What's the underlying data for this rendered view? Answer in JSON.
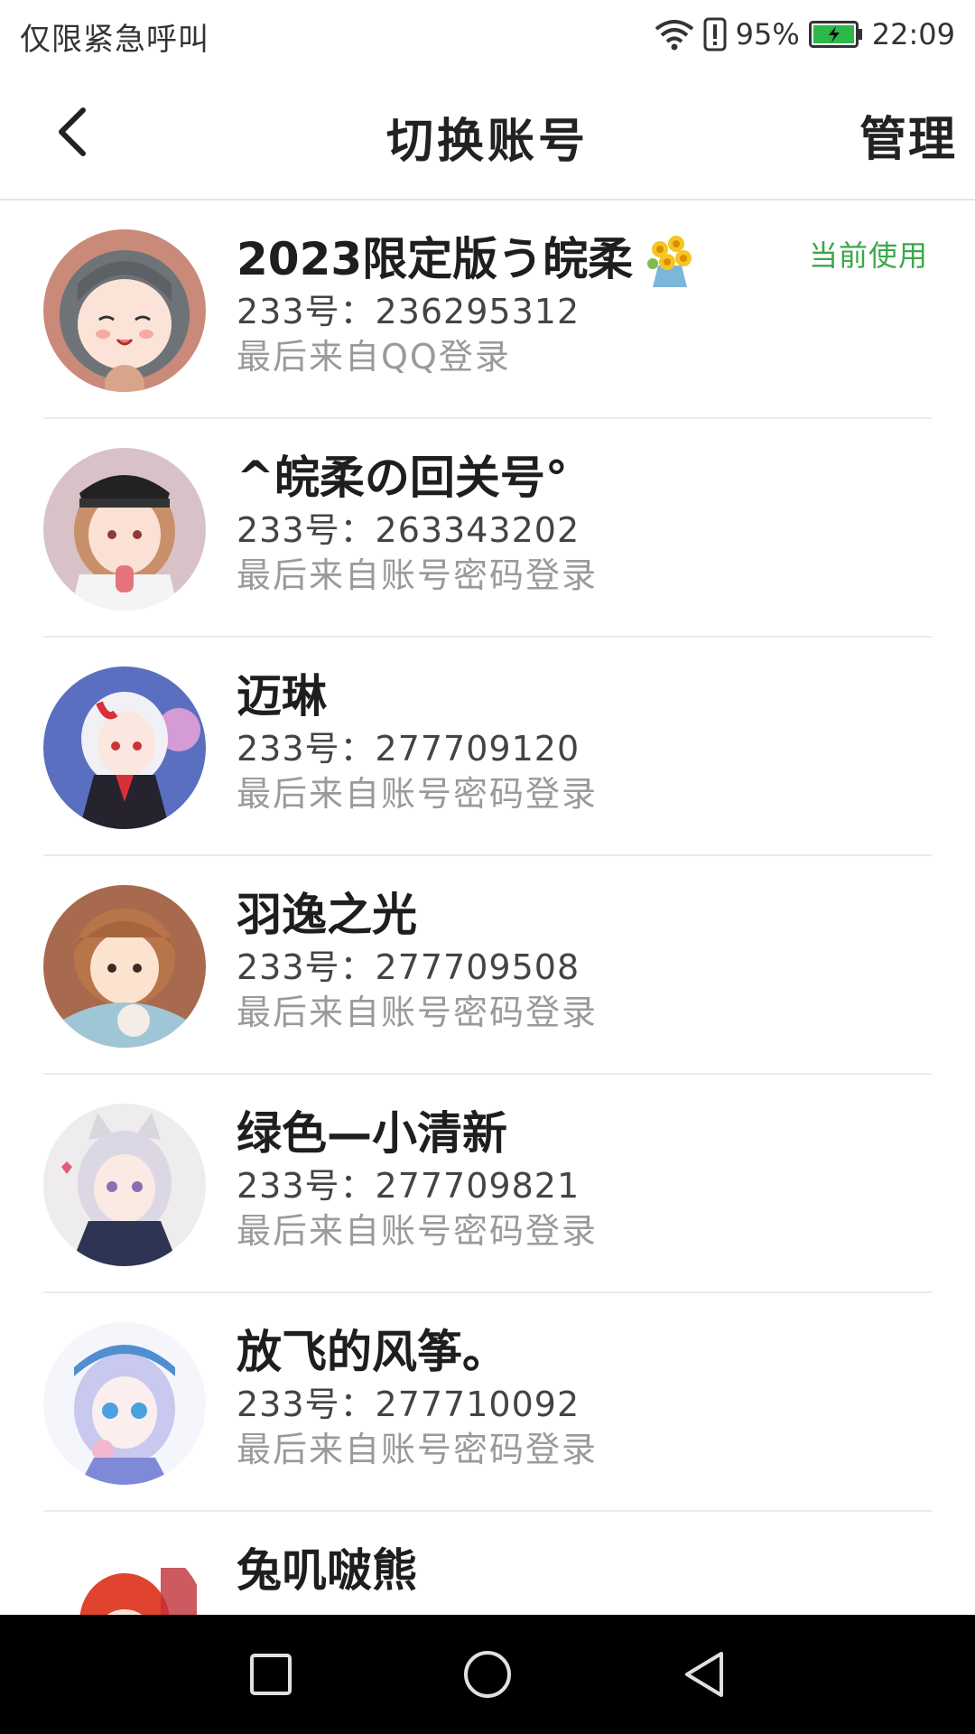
{
  "status_bar": {
    "carrier_text": "仅限紧急呼叫",
    "battery_percent": "95%",
    "time": "22:09",
    "icons": [
      "wifi-icon",
      "alert-icon",
      "battery-charging-icon"
    ]
  },
  "header": {
    "title": "切换账号",
    "manage_label": "管理",
    "back_icon": "chevron-left-icon"
  },
  "accounts": [
    {
      "name": "2023限定版う皖柔",
      "id_text": "233号：236295312",
      "login_text": "最后来自QQ登录",
      "badge": "当前使用",
      "emoji": "bouquet-icon"
    },
    {
      "name": "^皖柔の回关号°",
      "id_text": "233号：263343202",
      "login_text": "最后来自账号密码登录"
    },
    {
      "name": "迈琳",
      "id_text": "233号：277709120",
      "login_text": "最后来自账号密码登录"
    },
    {
      "name": "羽逸之光",
      "id_text": "233号：277709508",
      "login_text": "最后来自账号密码登录"
    },
    {
      "name": "绿色—小清新",
      "id_text": "233号：277709821",
      "login_text": "最后来自账号密码登录"
    },
    {
      "name": "放飞的风筝。",
      "id_text": "233号：277710092",
      "login_text": "最后来自账号密码登录"
    },
    {
      "name": "兔叽啵熊",
      "id_text": "",
      "login_text": ""
    }
  ],
  "colors": {
    "badge_green": "#3aa84a",
    "battery_green": "#2db84a",
    "nav_bar": "#000000"
  },
  "nav_bar": {
    "icons": [
      "recent-apps-icon",
      "home-icon",
      "back-triangle-icon"
    ]
  }
}
